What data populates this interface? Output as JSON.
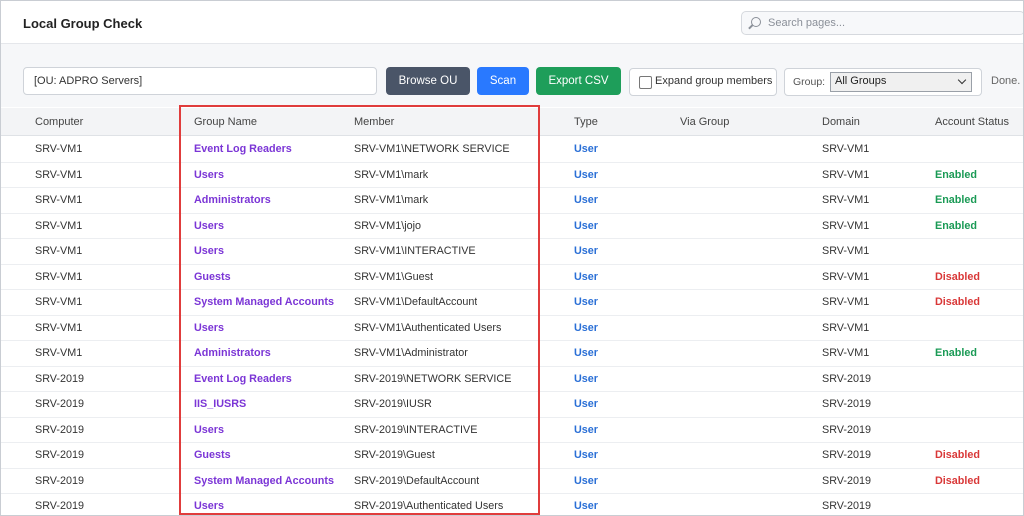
{
  "app": {
    "title": "Local Group Check"
  },
  "search": {
    "placeholder": "Search pages..."
  },
  "toolbar": {
    "ou_value": "[OU: ADPRO Servers]",
    "browse_label": "Browse OU",
    "scan_label": "Scan",
    "export_label": "Export CSV",
    "expand_label": "Expand group members",
    "group_label": "Group:",
    "group_selected": "All Groups",
    "status": "Done. C"
  },
  "table": {
    "headers": {
      "computer": "Computer",
      "group_name": "Group Name",
      "member": "Member",
      "type": "Type",
      "via_group": "Via Group",
      "domain": "Domain",
      "account_status": "Account Status"
    },
    "rows": [
      {
        "computer": "SRV-VM1",
        "group": "Event Log Readers",
        "member": "SRV-VM1\\NETWORK SERVICE",
        "type": "User",
        "via": "",
        "domain": "SRV-VM1",
        "status": ""
      },
      {
        "computer": "SRV-VM1",
        "group": "Users",
        "member": "SRV-VM1\\mark",
        "type": "User",
        "via": "",
        "domain": "SRV-VM1",
        "status": "Enabled"
      },
      {
        "computer": "SRV-VM1",
        "group": "Administrators",
        "member": "SRV-VM1\\mark",
        "type": "User",
        "via": "",
        "domain": "SRV-VM1",
        "status": "Enabled"
      },
      {
        "computer": "SRV-VM1",
        "group": "Users",
        "member": "SRV-VM1\\jojo",
        "type": "User",
        "via": "",
        "domain": "SRV-VM1",
        "status": "Enabled"
      },
      {
        "computer": "SRV-VM1",
        "group": "Users",
        "member": "SRV-VM1\\INTERACTIVE",
        "type": "User",
        "via": "",
        "domain": "SRV-VM1",
        "status": ""
      },
      {
        "computer": "SRV-VM1",
        "group": "Guests",
        "member": "SRV-VM1\\Guest",
        "type": "User",
        "via": "",
        "domain": "SRV-VM1",
        "status": "Disabled"
      },
      {
        "computer": "SRV-VM1",
        "group": "System Managed Accounts G",
        "member": "SRV-VM1\\DefaultAccount",
        "type": "User",
        "via": "",
        "domain": "SRV-VM1",
        "status": "Disabled"
      },
      {
        "computer": "SRV-VM1",
        "group": "Users",
        "member": "SRV-VM1\\Authenticated Users",
        "type": "User",
        "via": "",
        "domain": "SRV-VM1",
        "status": ""
      },
      {
        "computer": "SRV-VM1",
        "group": "Administrators",
        "member": "SRV-VM1\\Administrator",
        "type": "User",
        "via": "",
        "domain": "SRV-VM1",
        "status": "Enabled"
      },
      {
        "computer": "SRV-2019",
        "group": "Event Log Readers",
        "member": "SRV-2019\\NETWORK SERVICE",
        "type": "User",
        "via": "",
        "domain": "SRV-2019",
        "status": ""
      },
      {
        "computer": "SRV-2019",
        "group": "IIS_IUSRS",
        "member": "SRV-2019\\IUSR",
        "type": "User",
        "via": "",
        "domain": "SRV-2019",
        "status": ""
      },
      {
        "computer": "SRV-2019",
        "group": "Users",
        "member": "SRV-2019\\INTERACTIVE",
        "type": "User",
        "via": "",
        "domain": "SRV-2019",
        "status": ""
      },
      {
        "computer": "SRV-2019",
        "group": "Guests",
        "member": "SRV-2019\\Guest",
        "type": "User",
        "via": "",
        "domain": "SRV-2019",
        "status": "Disabled"
      },
      {
        "computer": "SRV-2019",
        "group": "System Managed Accounts G",
        "member": "SRV-2019\\DefaultAccount",
        "type": "User",
        "via": "",
        "domain": "SRV-2019",
        "status": "Disabled"
      },
      {
        "computer": "SRV-2019",
        "group": "Users",
        "member": "SRV-2019\\Authenticated Users",
        "type": "User",
        "via": "",
        "domain": "SRV-2019",
        "status": ""
      }
    ]
  },
  "colors": {
    "group_link": "#7b35d6",
    "type_link": "#2a6fd6",
    "enabled": "#1a9a55",
    "disabled": "#d93838",
    "highlight_border": "#e03c3c"
  }
}
